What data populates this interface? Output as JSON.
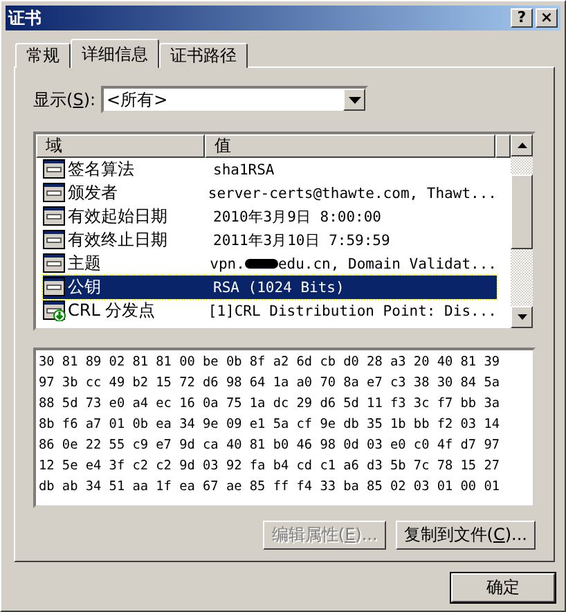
{
  "window": {
    "title": "证书",
    "help_button": "?",
    "close_button": "×"
  },
  "tabs": [
    {
      "label": "常规",
      "selected": false
    },
    {
      "label": "详细信息",
      "selected": true
    },
    {
      "label": "证书路径",
      "selected": false
    }
  ],
  "show": {
    "label": "显示(",
    "accel": "S",
    "label_after": "):",
    "value": "<所有>"
  },
  "fields": {
    "columns": [
      "域",
      "值"
    ],
    "rows": [
      {
        "kind": "field",
        "name": "签名算法",
        "value": "sha1RSA",
        "selected": false
      },
      {
        "kind": "field",
        "name": "颁发者",
        "value": "server-certs@thawte.com, Thawt...",
        "selected": false
      },
      {
        "kind": "field",
        "name": "有效起始日期",
        "value": "2010年3月9日 8:00:00",
        "selected": false
      },
      {
        "kind": "field",
        "name": "有效终止日期",
        "value": "2011年3月10日 7:59:59",
        "selected": false
      },
      {
        "kind": "field",
        "name": "主题",
        "value": "vpn.",
        "value_rest": "edu.cn, Domain Validat...",
        "selected": false
      },
      {
        "kind": "field",
        "name": "公钥",
        "value": "RSA (1024 Bits)",
        "selected": true
      },
      {
        "kind": "extension",
        "name": "CRL 分发点",
        "value": "[1]CRL Distribution Point: Dis...",
        "selected": false
      }
    ]
  },
  "detail_lines": [
    "30 81 89 02 81 81 00 be 0b 8f a2 6d cb d0 28 a3 20 40 81 39",
    "97 3b cc 49 b2 15 72 d6 98 64 1a a0 70 8a e7 c3 38 30 84 5a",
    "88 5d 73 e0 a4 ec 16 0a 75 1a dc 29 d6 5d 11 f3 3c f7 bb 3a",
    "8b f6 a7 01 0b ea 34 9e 09 e1 5a cf 9e db 35 1b bb f2 03 14",
    "86 0e 22 55 c9 e7 9d ca 40 81 b0 46 98 0d 03 e0 c0 4f d7 97",
    "12 5e e4 3f c2 c2 9d 03 92 fa b4 cd c1 a6 d3 5b 7c 78 15 27",
    "db ab 34 51 aa 1f ea 67 ae 85 ff f4 33 ba 85 02 03 01 00 01"
  ],
  "buttons": [
    {
      "label": "编辑属性(",
      "accel": "E",
      "suffix": ")...",
      "disabled": true
    },
    {
      "label": "复制到文件(",
      "accel": "C",
      "suffix": ")...",
      "disabled": false
    }
  ],
  "ok_button": "确定"
}
